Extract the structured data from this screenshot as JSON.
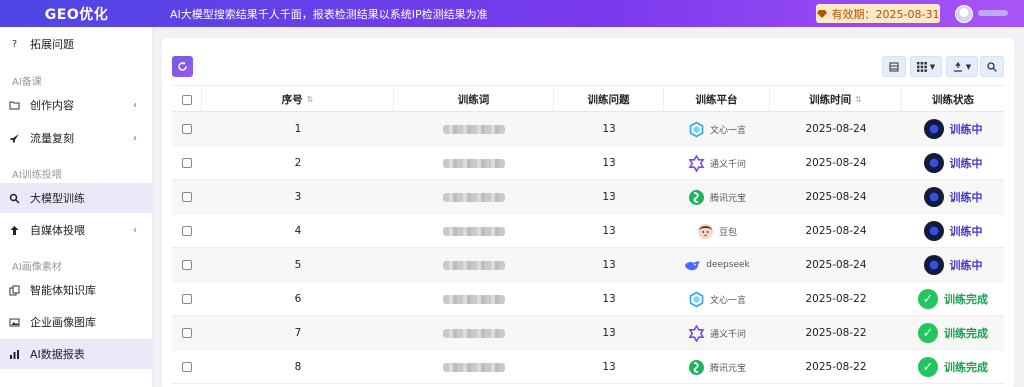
{
  "header": {
    "logo": "GEO优化",
    "notice": "AI大模型搜索结果千人千面，报表检测结果以系统IP检测结果为准",
    "expiry": "有效期：2025-08-31"
  },
  "sidebar": {
    "items": [
      {
        "label": "拓展问题",
        "icon": "question-icon",
        "chevron": ""
      },
      {
        "group": "AI备课"
      },
      {
        "label": "创作内容",
        "icon": "folder-icon",
        "chevron": "‹"
      },
      {
        "label": "流量复刻",
        "icon": "rocket-icon",
        "chevron": "‹"
      },
      {
        "group": "AI训练投喂"
      },
      {
        "label": "大模型训练",
        "icon": "search-icon",
        "chevron": ""
      },
      {
        "label": "自媒体投喂",
        "icon": "upload-icon",
        "chevron": "‹"
      },
      {
        "group": "AI画像素材"
      },
      {
        "label": "智能体知识库",
        "icon": "copy-icon",
        "chevron": ""
      },
      {
        "label": "企业画像图库",
        "icon": "image-icon",
        "chevron": ""
      },
      {
        "label": "AI数据报表",
        "icon": "chart-icon",
        "chevron": ""
      }
    ]
  },
  "table": {
    "columns": [
      "序号",
      "训练词",
      "训练问题",
      "训练平台",
      "训练时间",
      "训练状态"
    ],
    "rows": [
      {
        "no": "1",
        "questions": "13",
        "platform": "文心一言",
        "platform_icon": "wenxin-icon",
        "time": "2025-08-24",
        "status": "训练中",
        "state": "ing"
      },
      {
        "no": "2",
        "questions": "13",
        "platform": "通义千问",
        "platform_icon": "tongyi-icon",
        "time": "2025-08-24",
        "status": "训练中",
        "state": "ing"
      },
      {
        "no": "3",
        "questions": "13",
        "platform": "腾讯元宝",
        "platform_icon": "yuanbao-icon",
        "time": "2025-08-24",
        "status": "训练中",
        "state": "ing"
      },
      {
        "no": "4",
        "questions": "13",
        "platform": "豆包",
        "platform_icon": "doubao-icon",
        "time": "2025-08-24",
        "status": "训练中",
        "state": "ing"
      },
      {
        "no": "5",
        "questions": "13",
        "platform": "deepseek",
        "platform_icon": "deepseek-icon",
        "time": "2025-08-24",
        "status": "训练中",
        "state": "ing"
      },
      {
        "no": "6",
        "questions": "13",
        "platform": "文心一言",
        "platform_icon": "wenxin-icon",
        "time": "2025-08-22",
        "status": "训练完成",
        "state": "done"
      },
      {
        "no": "7",
        "questions": "13",
        "platform": "通义千问",
        "platform_icon": "tongyi-icon",
        "time": "2025-08-22",
        "status": "训练完成",
        "state": "done"
      },
      {
        "no": "8",
        "questions": "13",
        "platform": "腾讯元宝",
        "platform_icon": "yuanbao-icon",
        "time": "2025-08-22",
        "status": "训练完成",
        "state": "done"
      }
    ]
  },
  "colors": {
    "accent": "#6d5ae6",
    "training": "#4338ca",
    "done": "#16a34a"
  }
}
